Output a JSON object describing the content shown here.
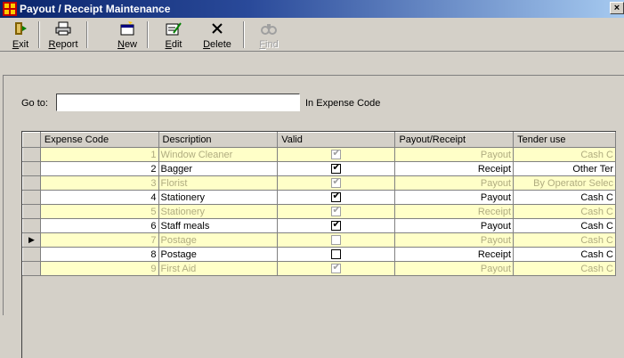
{
  "window": {
    "title": "Payout / Receipt Maintenance",
    "close_glyph": "×"
  },
  "toolbar": {
    "exit": {
      "accel": "E",
      "rest": "xit",
      "icon": "exit-door-icon"
    },
    "report": {
      "accel": "R",
      "rest": "eport",
      "icon": "printer-icon"
    },
    "new": {
      "accel": "N",
      "rest": "ew",
      "icon": "new-record-icon"
    },
    "edit": {
      "accel": "E",
      "rest": "dit",
      "icon": "edit-record-icon"
    },
    "delete": {
      "accel": "D",
      "rest": "elete",
      "icon": "delete-x-icon"
    },
    "find": {
      "accel": "F",
      "rest": "ind",
      "icon": "binoculars-icon",
      "disabled": true
    }
  },
  "goto": {
    "label": "Go to:",
    "value": "",
    "suffix": "In Expense Code"
  },
  "grid": {
    "columns": [
      "Expense Code",
      "Description",
      "Valid",
      "Payout/Receipt",
      "Tender use"
    ],
    "rows": [
      {
        "code": "1",
        "description": "Window Cleaner",
        "valid": true,
        "type": "Payout",
        "tender": "Cash C",
        "inactive": true,
        "current": false
      },
      {
        "code": "2",
        "description": "Bagger",
        "valid": true,
        "type": "Receipt",
        "tender": "Other Ter",
        "inactive": false,
        "current": false
      },
      {
        "code": "3",
        "description": "Florist",
        "valid": true,
        "type": "Payout",
        "tender": "By Operator Selec",
        "inactive": true,
        "current": false
      },
      {
        "code": "4",
        "description": "Stationery",
        "valid": true,
        "type": "Payout",
        "tender": "Cash C",
        "inactive": false,
        "current": false
      },
      {
        "code": "5",
        "description": "Stationery",
        "valid": true,
        "type": "Receipt",
        "tender": "Cash C",
        "inactive": true,
        "current": false
      },
      {
        "code": "6",
        "description": "Staff meals",
        "valid": true,
        "type": "Payout",
        "tender": "Cash C",
        "inactive": false,
        "current": false
      },
      {
        "code": "7",
        "description": "Postage",
        "valid": false,
        "type": "Payout",
        "tender": "Cash C",
        "inactive": true,
        "current": true
      },
      {
        "code": "8",
        "description": "Postage",
        "valid": false,
        "type": "Receipt",
        "tender": "Cash C",
        "inactive": false,
        "current": false
      },
      {
        "code": "9",
        "description": "First Aid",
        "valid": true,
        "type": "Payout",
        "tender": "Cash C",
        "inactive": true,
        "current": false
      }
    ],
    "current_row_glyph": "▶",
    "check_glyph": "✔"
  },
  "colors": {
    "title_start": "#0a246a",
    "inactive_row_bg": "#ffffc8",
    "inactive_row_text": "#b0ac80"
  }
}
